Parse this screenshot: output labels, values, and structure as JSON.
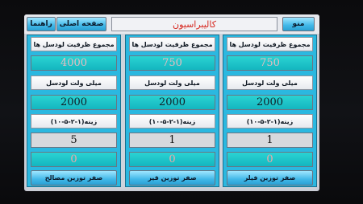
{
  "top_bar": {
    "menu_label": "منو",
    "title": "کالیبراسیون",
    "home_label": "صفحه اصلی",
    "guide_label": "راهنما"
  },
  "panels": {
    "left": {
      "header": "مجموع ظرفیت لودسل ها",
      "capacity_value": "4000",
      "mv_label": "میلی ولت لودسل",
      "mv_value": "2000",
      "step_label": "زینه(۱-۲-۵-۱۰)",
      "step_value": "5",
      "zero_value": "0",
      "bottom_button": "صفر توزین مصالح"
    },
    "middle": {
      "header": "مجموع ظرفیت لودسل ها",
      "capacity_value": "750",
      "mv_label": "میلی ولت لودسل",
      "mv_value": "2000",
      "step_label": "زینه(۱-۲-۵-۱۰)",
      "step_value": "1",
      "zero_value": "0",
      "bottom_button": "صفر توزین قیر"
    },
    "right": {
      "header": "مجموع ظرفیت لودسل ها",
      "capacity_value": "750",
      "mv_label": "میلی ولت لودسل",
      "mv_value": "2000",
      "step_label": "زینه(۱-۲-۵-۱۰)",
      "step_value": "1",
      "zero_value": "0",
      "bottom_button": "صفر توزین فیلر"
    }
  }
}
